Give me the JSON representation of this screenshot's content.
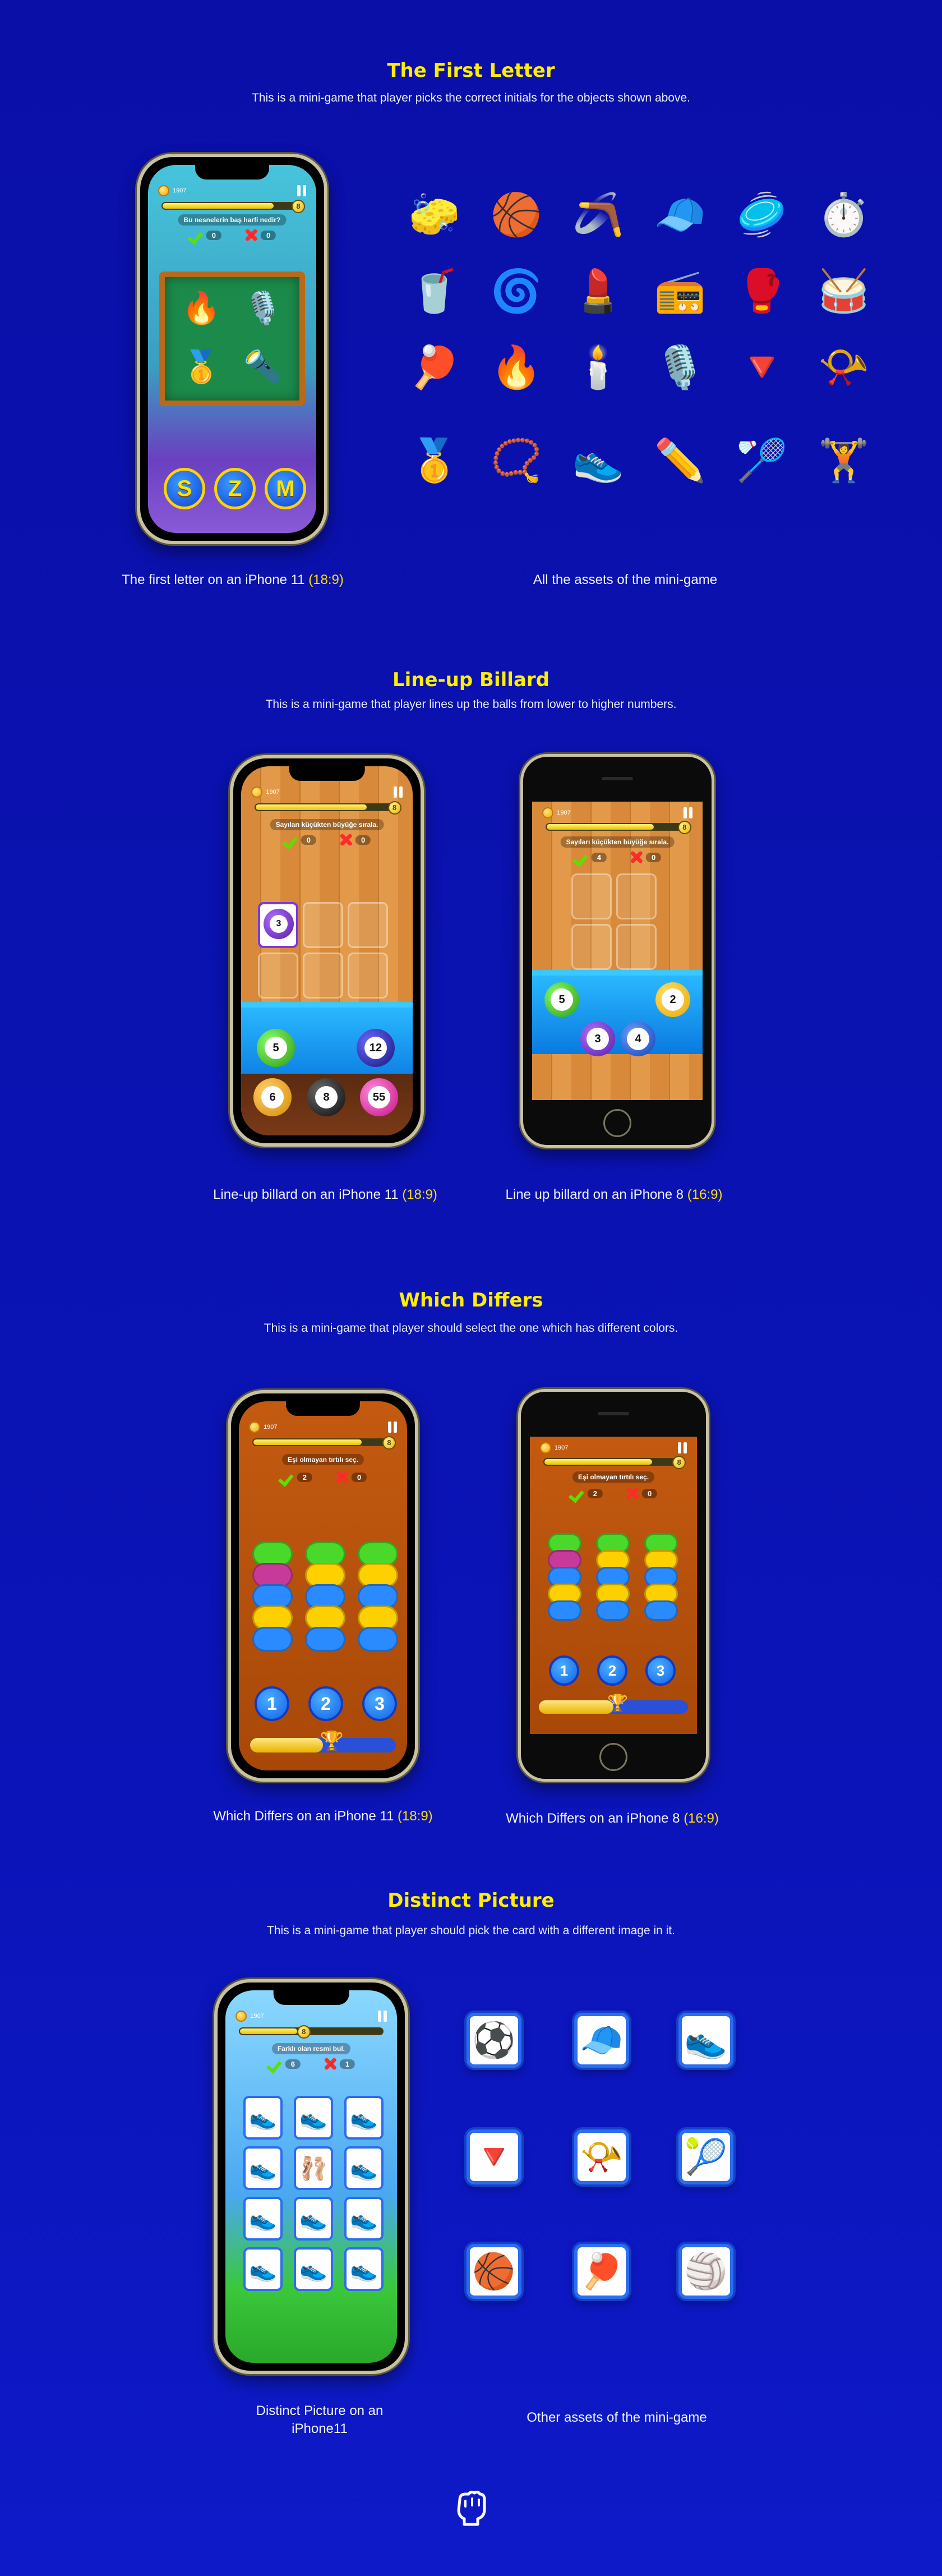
{
  "sections": {
    "first_letter": {
      "title": "The First Letter",
      "subtitle": "This is a mini-game that player picks the correct initials for the objects shown above.",
      "caption_phone": "The first letter on an iPhone 11",
      "caption_phone_ratio": "(18:9)",
      "caption_assets": "All the assets of the mini-game",
      "coins": "1907",
      "prompt": "Bu nesnelerin baş harfi nedir?",
      "correct": "0",
      "wrong": "0",
      "letters": [
        "S",
        "Z",
        "M"
      ],
      "board_items": [
        "🔥",
        "🎙️",
        "🥇",
        "🔦"
      ],
      "assets": [
        "🧽",
        "🏀",
        "🪃",
        "🧢",
        "🥏",
        "⏱️",
        "🥤",
        "🌀",
        "💄",
        "📻",
        "🥊",
        "🥁",
        "🏓",
        "🔥",
        "🕯️",
        "🎙️",
        "🔻",
        "📯",
        "🥇",
        "📿",
        "👟",
        "✏️",
        "🏸",
        "🏋️"
      ]
    },
    "billard": {
      "title": "Line-up Billard",
      "subtitle": "This is a mini-game that player lines up the balls from lower to higher numbers.",
      "caption_11": "Line-up billard on an iPhone 11",
      "caption_11_ratio": "(18:9)",
      "caption_8": "Line up billard on an iPhone 8",
      "caption_8_ratio": "(16:9)",
      "coins": "1907",
      "prompt": "Sayıları küçükten büyüğe sırala.",
      "score_11": {
        "correct": "0",
        "wrong": "0"
      },
      "score_8": {
        "correct": "4",
        "wrong": "0"
      },
      "placed_11": "3",
      "balls_11": [
        "5",
        "12",
        "6",
        "8",
        "55"
      ],
      "balls_8": [
        "5",
        "2",
        "3",
        "4"
      ]
    },
    "differs": {
      "title": "Which Differs",
      "subtitle": "This is a mini-game that player should select the one which has different colors.",
      "caption_11": "Which Differs on an iPhone 11",
      "caption_11_ratio": "(18:9)",
      "caption_8": "Which Differs on an iPhone 8",
      "caption_8_ratio": "(16:9)",
      "coins": "1907",
      "prompt": "Eşi olmayan tırtılı seç.",
      "score": {
        "correct": "2",
        "wrong": "0"
      },
      "buttons": [
        "1",
        "2",
        "3"
      ]
    },
    "distinct": {
      "title": "Distinct Picture",
      "subtitle": "This is a mini-game that player should pick the card with a different image in it.",
      "caption_phone": "Distinct Picture on an iPhone11",
      "caption_assets": "Other assets of the mini-game",
      "coins": "1907",
      "prompt": "Farklı olan resmi bul.",
      "score": {
        "correct": "6",
        "wrong": "1"
      },
      "assets": [
        "⚽",
        "🧢",
        "👟",
        "🔻",
        "📯",
        "🎾",
        "🏀",
        "🏓",
        "🏐"
      ]
    }
  },
  "colors": {
    "title": "#ffee00",
    "background": "#0a12b0",
    "ratio": "#ffe100"
  },
  "footer_icon": "fist-logo-icon"
}
